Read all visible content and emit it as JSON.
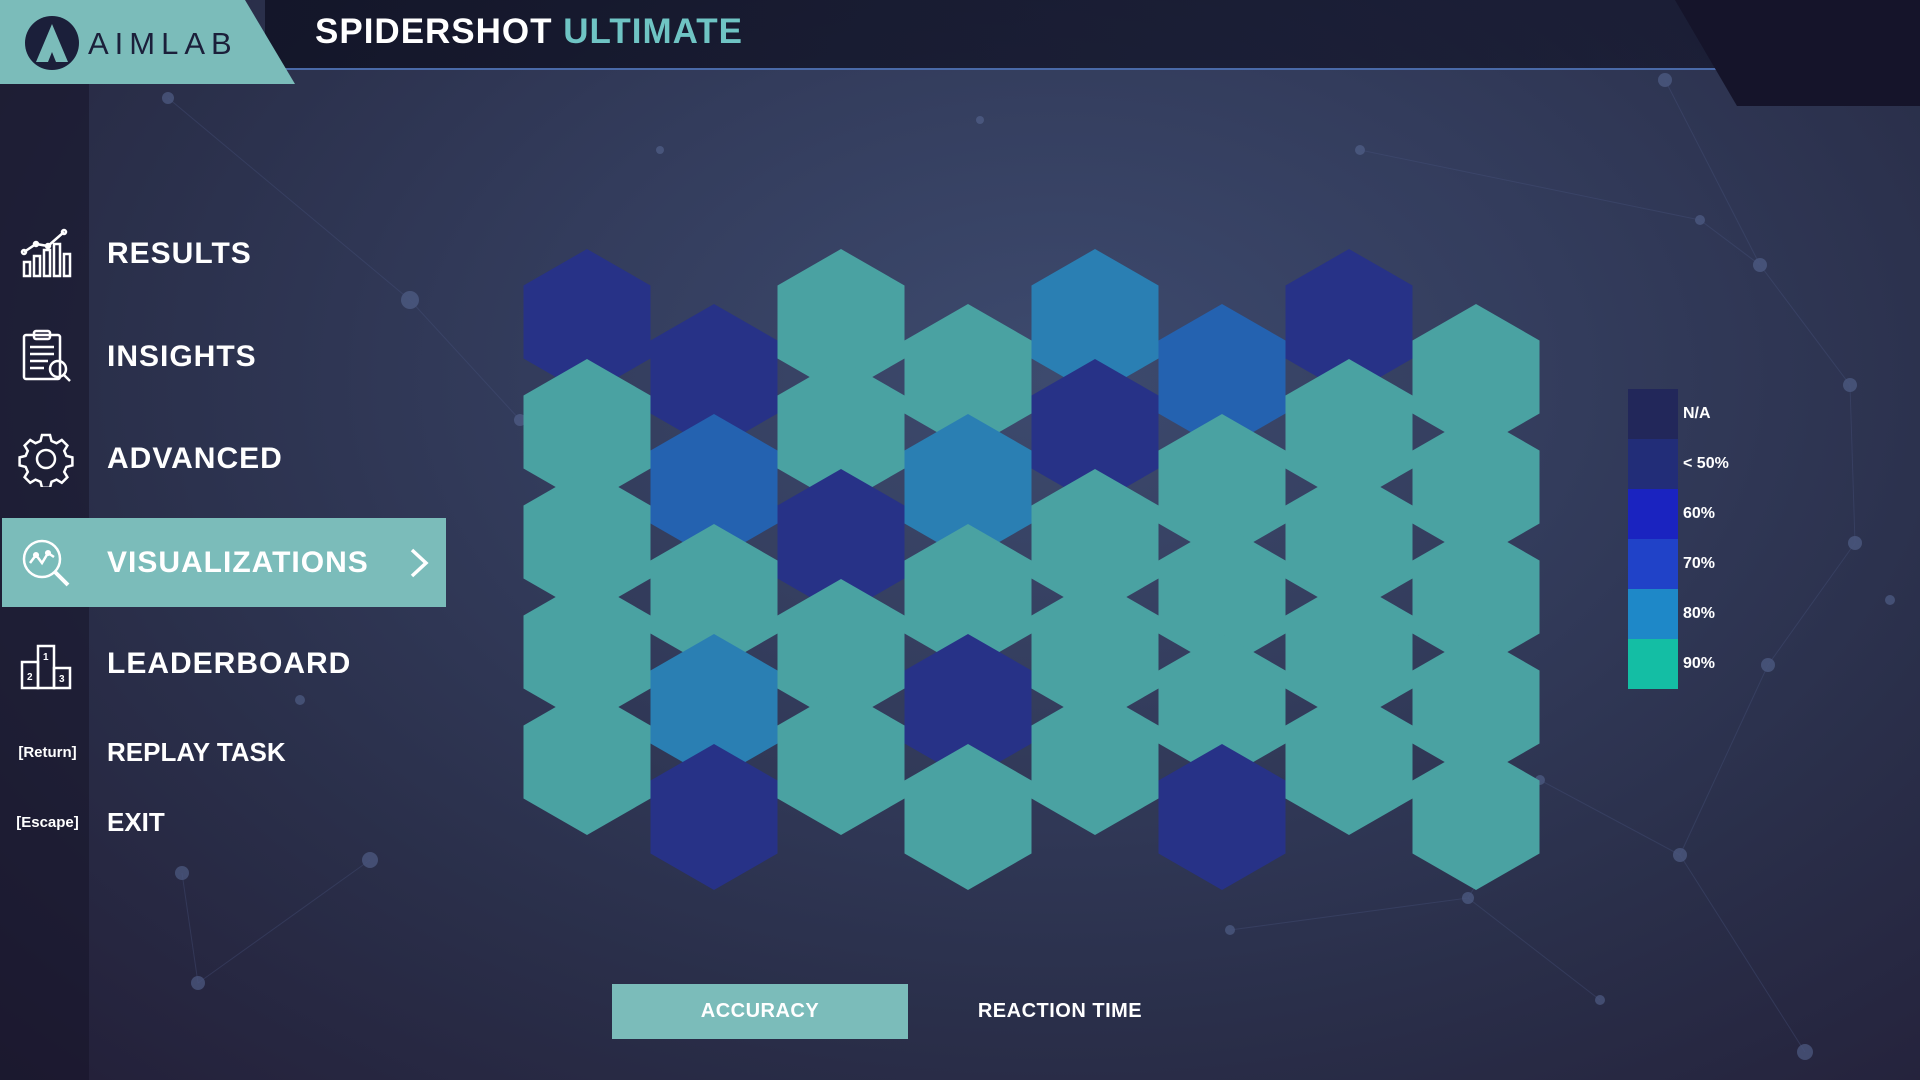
{
  "app": {
    "logo_text": "AIMLAB"
  },
  "header": {
    "title_main": "SPIDERSHOT",
    "title_accent": "ULTIMATE"
  },
  "sidebar": {
    "items": [
      {
        "label": "RESULTS",
        "icon": "bar-chart-icon",
        "active": false
      },
      {
        "label": "INSIGHTS",
        "icon": "clipboard-icon",
        "active": false
      },
      {
        "label": "ADVANCED",
        "icon": "gear-icon",
        "active": false
      },
      {
        "label": "VISUALIZATIONS",
        "icon": "magnifier-chart-icon",
        "active": true
      },
      {
        "label": "LEADERBOARD",
        "icon": "podium-icon",
        "active": false
      }
    ],
    "actions": [
      {
        "key": "[Return]",
        "label": "REPLAY TASK"
      },
      {
        "key": "[Escape]",
        "label": "EXIT"
      }
    ]
  },
  "chart_data": {
    "type": "heatmap",
    "layout": "hexagonal",
    "rows": 5,
    "cols": 8,
    "values": [
      [
        "<50%",
        "<50%",
        "90%",
        "90%",
        "80%",
        "70%",
        "<50%",
        "90%"
      ],
      [
        "90%",
        "70%",
        "90%",
        "80%",
        "<50%",
        "90%",
        "90%",
        "90%"
      ],
      [
        "90%",
        "90%",
        "<50%",
        "90%",
        "90%",
        "90%",
        "90%",
        "90%"
      ],
      [
        "90%",
        "80%",
        "90%",
        "<50%",
        "90%",
        "90%",
        "90%",
        "90%"
      ],
      [
        "90%",
        "<50%",
        "90%",
        "90%",
        "90%",
        "<50%",
        "90%",
        "90%"
      ]
    ],
    "legend": [
      {
        "label": "N/A",
        "color": "#22275a"
      },
      {
        "label": "< 50%",
        "color": "#222d78"
      },
      {
        "label": "60%",
        "color": "#1a23c0"
      },
      {
        "label": "70%",
        "color": "#2042c8"
      },
      {
        "label": "80%",
        "color": "#1e88c8"
      },
      {
        "label": "90%",
        "color": "#14bea4"
      }
    ],
    "cell_colors": {
      "<50%": "#273287",
      "70%": "#2462b0",
      "80%": "#2a7fb3",
      "90%": "#4aa2a2"
    }
  },
  "tabs": [
    {
      "label": "ACCURACY",
      "active": true
    },
    {
      "label": "REACTION TIME",
      "active": false
    }
  ],
  "colors": {
    "accent": "#7bbcba",
    "title_accent": "#6fc4c4"
  }
}
